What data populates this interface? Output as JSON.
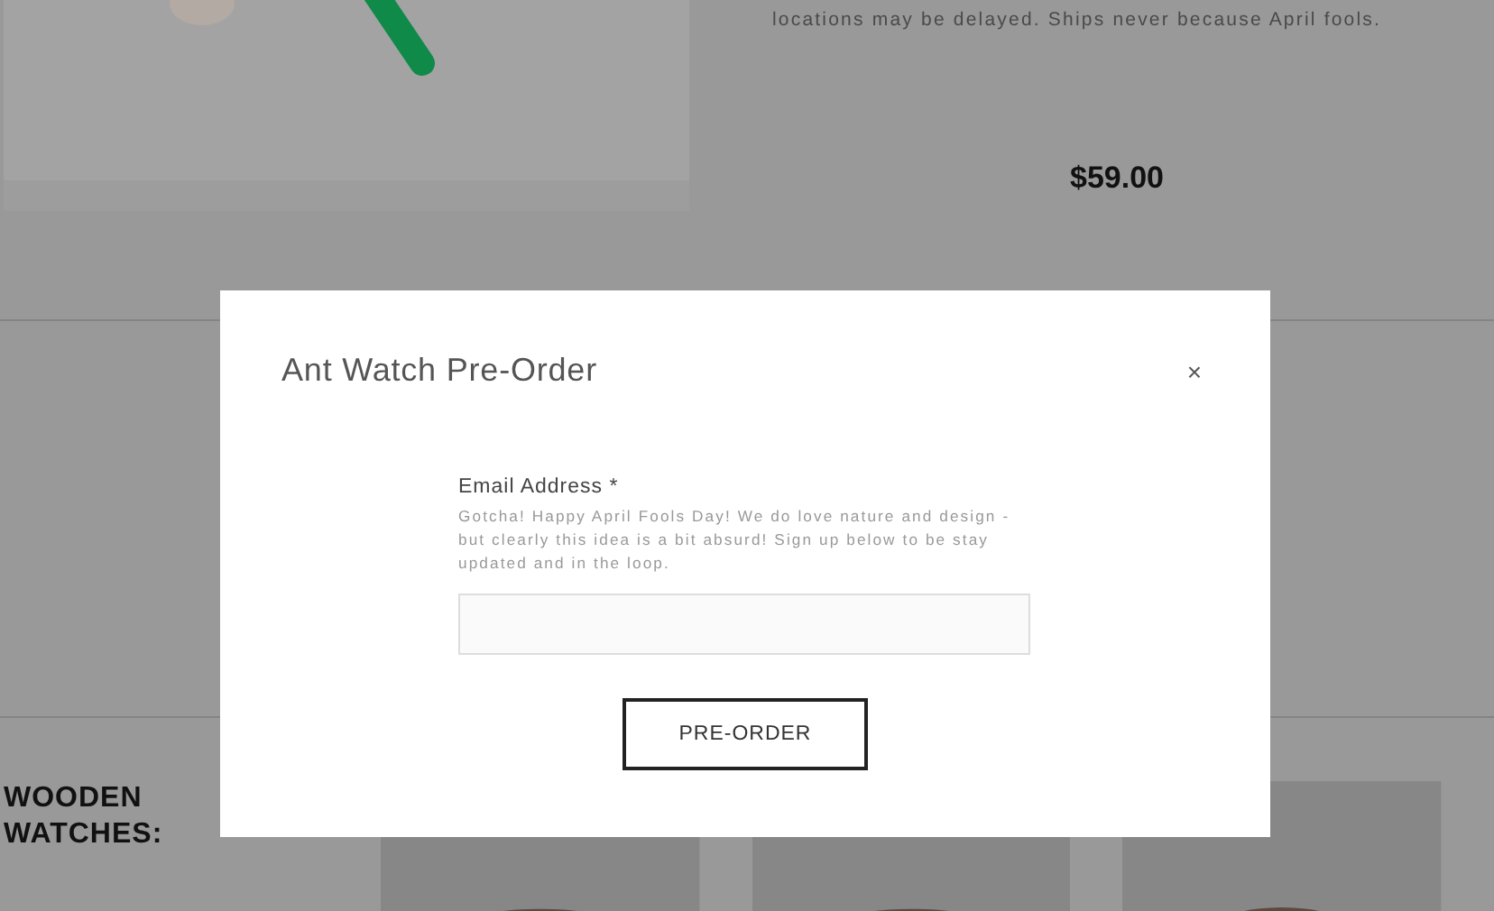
{
  "product": {
    "note": "locations may be delayed. Ships never because April fools.",
    "price": "$59.00"
  },
  "section": {
    "heading": "WOODEN WATCHES:"
  },
  "modal": {
    "title": "Ant Watch Pre-Order",
    "close": "×",
    "field_label": "Email Address *",
    "help": "Gotcha! Happy April Fools Day! We do love nature and design - but clearly this idea is a bit absurd! Sign up below to be stay updated and in the loop.",
    "button": "PRE-ORDER"
  }
}
